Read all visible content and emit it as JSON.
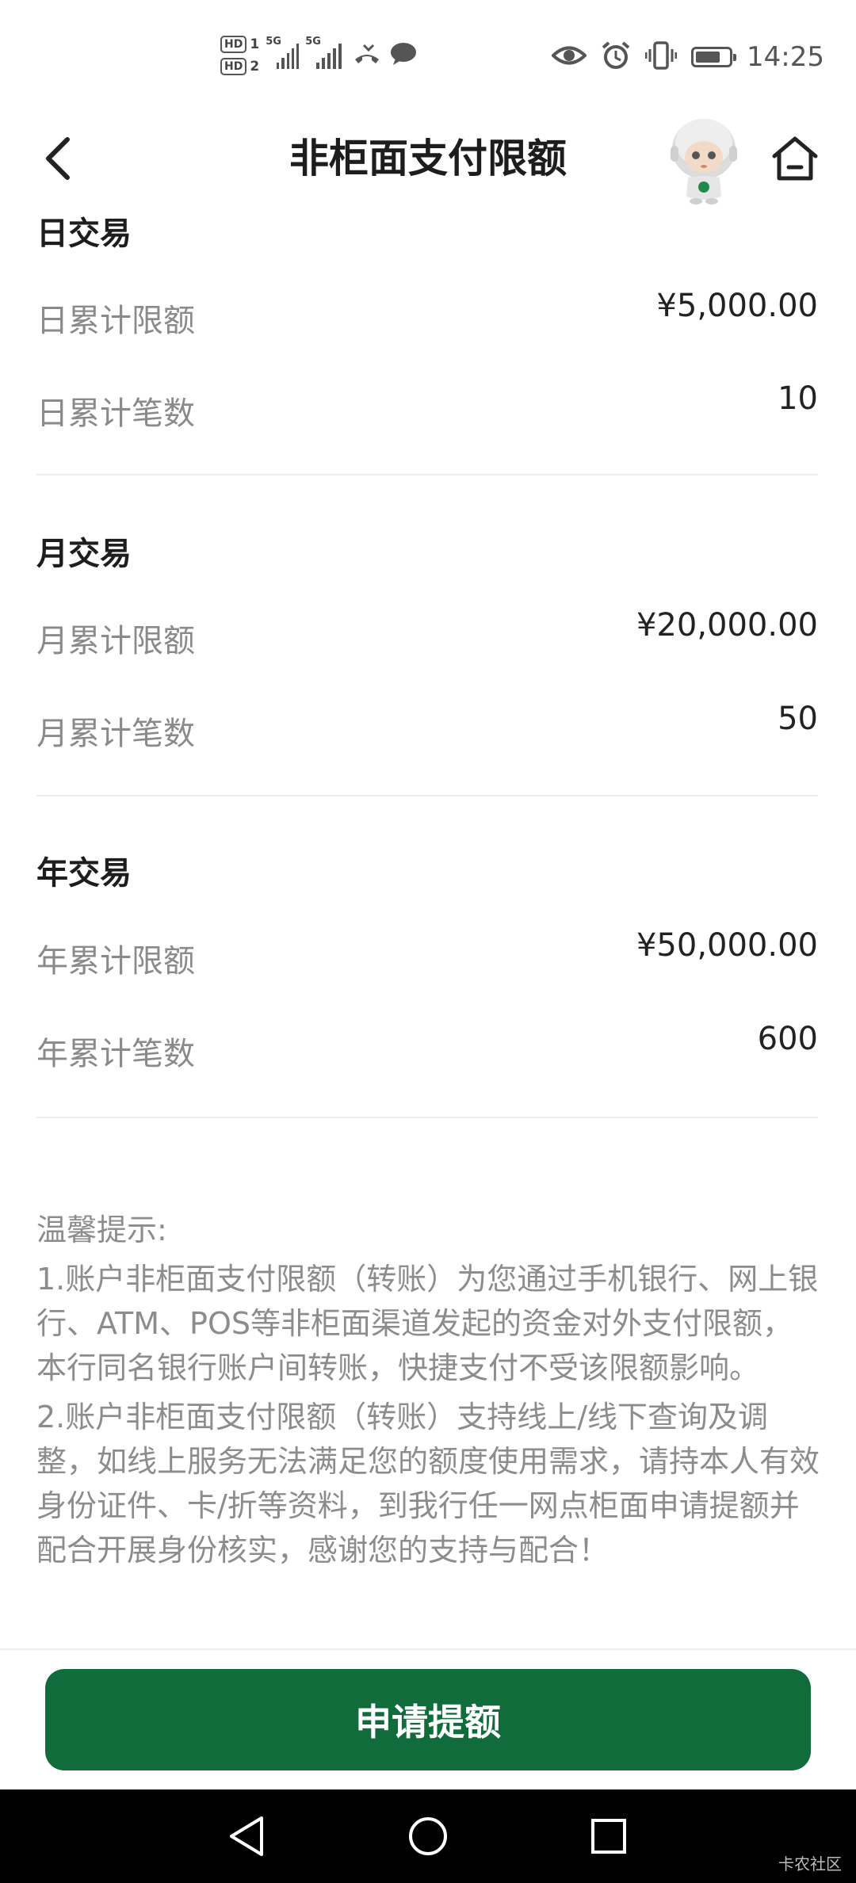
{
  "status_bar": {
    "hd1": "HD",
    "hd1_num": "1",
    "hd2": "HD",
    "hd2_num": "2",
    "net1": "5G",
    "net2": "5G",
    "time": "14:25",
    "battery_level": 0.75,
    "icons": [
      "missed-call-icon",
      "message-icon",
      "eye-icon",
      "alarm-icon",
      "vibrate-icon",
      "battery-icon"
    ]
  },
  "header": {
    "title": "非柜面支付限额",
    "icons": [
      "back-chevron-icon",
      "robot-mascot-icon",
      "home-icon"
    ]
  },
  "sections": [
    {
      "title": "日交易",
      "rows": [
        {
          "label": "日累计限额",
          "value": "¥5,000.00"
        },
        {
          "label": "日累计笔数",
          "value": "10"
        }
      ]
    },
    {
      "title": "月交易",
      "rows": [
        {
          "label": "月累计限额",
          "value": "¥20,000.00"
        },
        {
          "label": "月累计笔数",
          "value": "50"
        }
      ]
    },
    {
      "title": "年交易",
      "rows": [
        {
          "label": "年累计限额",
          "value": "¥50,000.00"
        },
        {
          "label": "年累计笔数",
          "value": "600"
        }
      ]
    }
  ],
  "tips": {
    "heading": "温馨提示:",
    "items": [
      "1.账户非柜面支付限额（转账）为您通过手机银行、网上银行、ATM、POS等非柜面渠道发起的资金对外支付限额，本行同名银行账户间转账，快捷支付不受该限额影响。",
      "2.账户非柜面支付限额（转账）支持线上/线下查询及调整，如线上服务无法满足您的额度使用需求，请持本人有效身份证件、卡/折等资料，到我行任一网点柜面申请提额并配合开展身份核实，感谢您的支持与配合！"
    ]
  },
  "action": {
    "apply_label": "申请提额"
  },
  "navbar": {
    "icons": [
      "nav-back-icon",
      "nav-home-icon",
      "nav-recents-icon"
    ],
    "watermark": "卡农社区"
  },
  "colors": {
    "primary_green": "#116c3c",
    "label_gray": "#8a8a8a",
    "divider": "#ededed"
  }
}
